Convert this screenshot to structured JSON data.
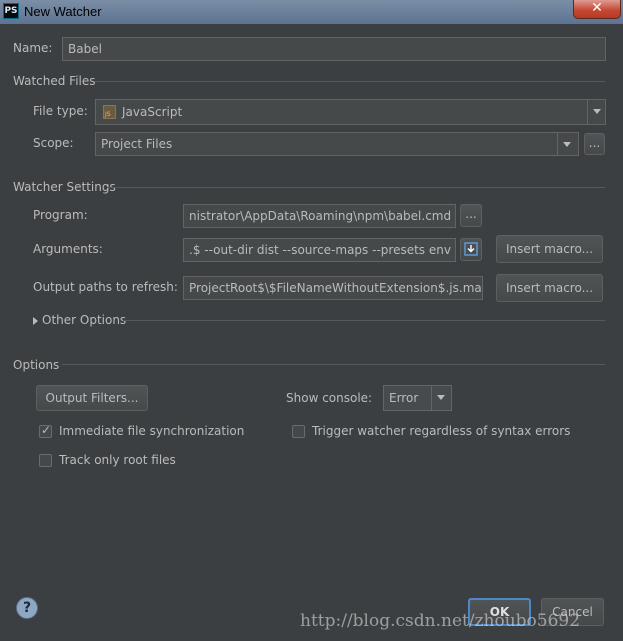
{
  "window": {
    "title": "New Watcher",
    "app_icon": "PS",
    "close_glyph": "✕"
  },
  "name_field": {
    "label": "Name:",
    "value": "Babel"
  },
  "watched_files": {
    "section_title": "Watched Files",
    "file_type": {
      "label": "File type:",
      "value": "JavaScript",
      "icon": "javascript-file-icon"
    },
    "scope": {
      "label": "Scope:",
      "value": "Project Files",
      "browse_label": "..."
    }
  },
  "watcher_settings": {
    "section_title": "Watcher Settings",
    "program": {
      "label": "Program:",
      "value": "nistrator\\AppData\\Roaming\\npm\\babel.cmd",
      "browse_label": "..."
    },
    "arguments": {
      "label": "Arguments:",
      "value": ".$ --out-dir dist --source-maps --presets env",
      "insert_macro_label": "Insert macro..."
    },
    "output_paths": {
      "label": "Output paths to refresh:",
      "value": "ProjectRoot$\\$FileNameWithoutExtension$.js.map",
      "insert_macro_label": "Insert macro..."
    },
    "other_options_label": "Other Options"
  },
  "options": {
    "section_title": "Options",
    "output_filters_label": "Output Filters...",
    "show_console_label": "Show console:",
    "show_console_value": "Error",
    "immediate_sync": {
      "label": "Immediate file synchronization",
      "checked": true
    },
    "trigger_watcher": {
      "label": "Trigger watcher regardless of syntax errors",
      "checked": false
    },
    "track_root": {
      "label": "Track only root files",
      "checked": false
    }
  },
  "footer": {
    "help_glyph": "?",
    "ok_label": "OK",
    "cancel_label": "Cancel"
  },
  "watermark": "http://blog.csdn.net/zhoubo5692",
  "colors": {
    "background": "#3c3f41",
    "field": "#45494a",
    "ok_border": "#4a88c7",
    "text": "#bbbbbb"
  }
}
